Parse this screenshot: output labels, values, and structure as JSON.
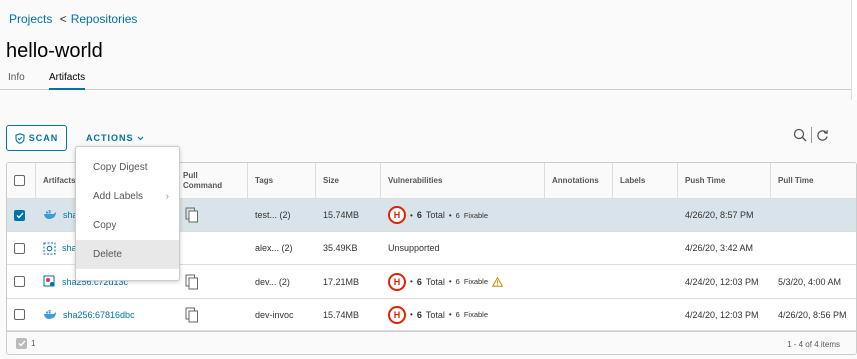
{
  "breadcrumb": {
    "projects": "Projects",
    "separator": "<",
    "repositories": "Repositories"
  },
  "page_title": "hello-world",
  "tabs": [
    {
      "label": "Info"
    },
    {
      "label": "Artifacts"
    }
  ],
  "toolbar": {
    "scan_label": "SCAN",
    "actions_label": "ACTIONS"
  },
  "dropdown": {
    "items": [
      "Copy Digest",
      "Add Labels",
      "Copy",
      "Delete"
    ]
  },
  "table": {
    "columns": {
      "artifacts": "Artifacts",
      "pull_command_1": "Pull",
      "pull_command_2": "Command",
      "tags": "Tags",
      "size": "Size",
      "vulnerabilities": "Vulnerabilities",
      "annotations": "Annotations",
      "labels": "Labels",
      "push_time": "Push Time",
      "pull_time": "Pull Time"
    },
    "rows": [
      {
        "artifact": "sha",
        "tags": "test... (2)",
        "size": "15.74MB",
        "severity": "H",
        "vuln_total": "6",
        "total_word": "Total",
        "vuln_fixable": "6",
        "fixable_word": "Fixable",
        "push_time": "4/26/20, 8:57 PM",
        "pull_time": ""
      },
      {
        "artifact": "sha",
        "tags": "alex... (2)",
        "size": "35.49KB",
        "vuln_text": "Unsupported",
        "push_time": "4/26/20, 3:42 AM",
        "pull_time": ""
      },
      {
        "artifact": "sha256:c72d13c",
        "tags": "dev... (2)",
        "size": "17.21MB",
        "severity": "H",
        "vuln_total": "6",
        "total_word": "Total",
        "vuln_fixable": "6",
        "fixable_word": "Fixable",
        "push_time": "4/24/20, 12:03 PM",
        "pull_time": "5/3/20, 4:00 AM"
      },
      {
        "artifact": "sha256:67816dbc",
        "tags": "dev-invoc",
        "size": "15.74MB",
        "severity": "H",
        "vuln_total": "6",
        "total_word": "Total",
        "vuln_fixable": "6",
        "fixable_word": "Fixable",
        "push_time": "4/24/20, 12:03 PM",
        "pull_time": "4/26/20, 8:56 PM"
      }
    ]
  },
  "footer": {
    "selected_count": "1",
    "pagination": "1 - 4 of 4 items"
  },
  "colors": {
    "link": "#0072a3",
    "critical": "#e12200",
    "selected_row": "#d9e4ea",
    "warning": "#efc006"
  }
}
